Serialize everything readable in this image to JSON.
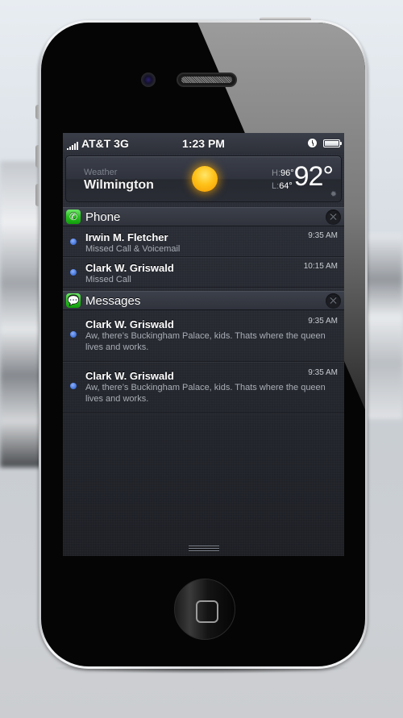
{
  "status_bar": {
    "carrier": "AT&T 3G",
    "time": "1:23 PM",
    "signal_bars": 5,
    "battery_level": 1.0
  },
  "weather": {
    "app_label": "Weather",
    "city": "Wilmington",
    "condition_icon": "sun-icon",
    "high_label": "H:",
    "high": "96°",
    "low_label": "L:",
    "low": "64°",
    "current_temp": "92°",
    "settings_icon": "gear-icon"
  },
  "sections": [
    {
      "app": "Phone",
      "icon": "phone-icon",
      "notifications": [
        {
          "name": "Irwin M. Fletcher",
          "detail": "Missed Call & Voicemail",
          "time": "9:35 AM"
        },
        {
          "name": "Clark W. Griswald",
          "detail": "Missed Call",
          "time": "10:15 AM"
        }
      ]
    },
    {
      "app": "Messages",
      "icon": "messages-icon",
      "notifications": [
        {
          "name": "Clark W. Griswald",
          "detail": "Aw, there’s Buckingham Palace, kids. Thats where the queen lives and works.",
          "time": "9:35 AM"
        },
        {
          "name": "Clark W. Griswald",
          "detail": "Aw, there’s Buckingham Palace, kids. Thats where the queen lives and works.",
          "time": "9:35 AM"
        }
      ]
    }
  ],
  "colors": {
    "unread_dot": "#3d6fd6",
    "app_icon_green": "#28c21f",
    "sun": "#ffc21a"
  }
}
